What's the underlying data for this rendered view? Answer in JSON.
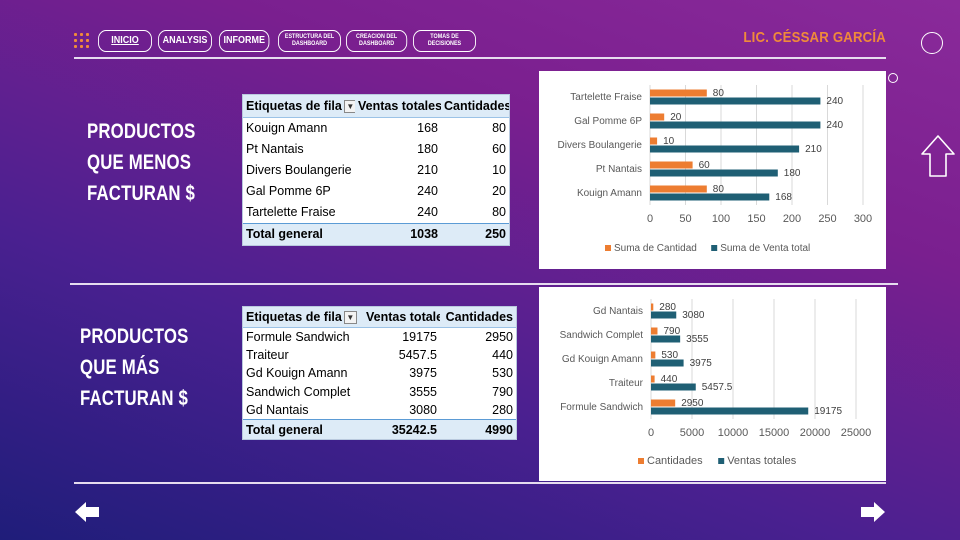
{
  "nav": {
    "items": [
      {
        "label": "INICIO",
        "active": true
      },
      {
        "label": "ANALYSIS"
      },
      {
        "label": "INFORME"
      },
      {
        "label": "ESTRUCTURA DEL DASHBOARD"
      },
      {
        "label": "CREACION DEL DASHBOARD"
      },
      {
        "label": "TOMAS DE DECISIONES"
      }
    ],
    "author": "LIC. CÉSSAR GARCÍA"
  },
  "colors": {
    "accent_orange": "#f08a3a",
    "series_cantidad": "#ed7d31",
    "series_ventas": "#1f5f74",
    "table_header": "#ddebf7"
  },
  "section1": {
    "heading": "PRODUCTOS QUE MENOS FACTURAN $",
    "table": {
      "headers": [
        "Etiquetas de fila",
        "Ventas totales",
        "Cantidades"
      ],
      "rows": [
        [
          "Kouign Amann",
          "168",
          "80"
        ],
        [
          "Pt Nantais",
          "180",
          "60"
        ],
        [
          "Divers Boulangerie",
          "210",
          "10"
        ],
        [
          "Gal Pomme 6P",
          "240",
          "20"
        ],
        [
          "Tartelette Fraise",
          "240",
          "80"
        ]
      ],
      "total": [
        "Total general",
        "1038",
        "250"
      ]
    }
  },
  "section2": {
    "heading": "PRODUCTOS QUE MÁS FACTURAN $",
    "table": {
      "headers": [
        "Etiquetas de fila",
        "Ventas totales",
        "Cantidades"
      ],
      "rows": [
        [
          "Formule Sandwich",
          "19175",
          "2950"
        ],
        [
          "Traiteur",
          "5457.5",
          "440"
        ],
        [
          "Gd Kouign Amann",
          "3975",
          "530"
        ],
        [
          "Sandwich Complet",
          "3555",
          "790"
        ],
        [
          "Gd Nantais",
          "3080",
          "280"
        ]
      ],
      "total": [
        "Total general",
        "35242.5",
        "4990"
      ]
    }
  },
  "chart_data": [
    {
      "type": "bar",
      "orientation": "horizontal",
      "categories": [
        "Tartelette Fraise",
        "Gal Pomme 6P",
        "Divers Boulangerie",
        "Pt Nantais",
        "Kouign Amann"
      ],
      "series": [
        {
          "name": "Suma de Cantidad",
          "values": [
            80,
            20,
            10,
            60,
            80
          ],
          "color": "#ed7d31"
        },
        {
          "name": "Suma de Venta total",
          "values": [
            240,
            240,
            210,
            180,
            168
          ],
          "color": "#1f5f74"
        }
      ],
      "xlim": [
        0,
        300
      ],
      "xticks": [
        0,
        50,
        100,
        150,
        200,
        250,
        300
      ],
      "grid": true,
      "legend": "bottom"
    },
    {
      "type": "bar",
      "orientation": "horizontal",
      "categories": [
        "Gd Nantais",
        "Sandwich Complet",
        "Gd Kouign Amann",
        "Traiteur",
        "Formule Sandwich"
      ],
      "series": [
        {
          "name": "Cantidades",
          "values": [
            280,
            790,
            530,
            440,
            2950
          ],
          "color": "#ed7d31"
        },
        {
          "name": "Ventas totales",
          "values": [
            3080,
            3555,
            3975,
            5457.5,
            19175
          ],
          "color": "#1f5f74"
        }
      ],
      "xlim": [
        0,
        25000
      ],
      "xticks": [
        0,
        5000,
        10000,
        15000,
        20000,
        25000
      ],
      "grid": true,
      "legend": "bottom"
    }
  ],
  "icons": {
    "menu": "grid-menu-icon",
    "home": "up-arrow-icon",
    "prev": "left-arrow-icon",
    "next": "right-arrow-icon"
  }
}
